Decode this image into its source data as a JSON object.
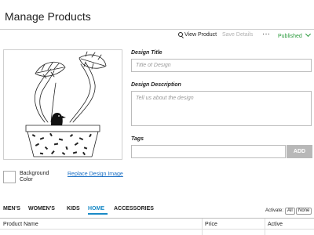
{
  "header": {
    "title": "Manage Products"
  },
  "toolbar": {
    "view_product": "View Product",
    "save_details": "Save Details",
    "more": "···",
    "status": "Published"
  },
  "design_image": {
    "icon": "monstera-plant-in-pot-illustration"
  },
  "background": {
    "label": "Background Color"
  },
  "replace_link": "Replace Design Image",
  "form": {
    "title_label": "Design Title",
    "title_placeholder": "Title of Design",
    "title_value": "",
    "description_label": "Design Description",
    "description_placeholder": "Tell us about the design",
    "description_value": "",
    "tags_label": "Tags",
    "tags_value": "",
    "add_button": "ADD"
  },
  "categories": {
    "tabs": [
      "MEN'S",
      "WOMEN'S",
      "KIDS",
      "HOME",
      "ACCESSORIES"
    ],
    "active": "HOME"
  },
  "activate": {
    "label": "Activate:",
    "all": "All",
    "none": "None"
  },
  "table": {
    "columns": [
      "Product Name",
      "Price",
      "Active"
    ]
  },
  "colors": {
    "accent": "#1a8ac6",
    "published": "#2a9a3c",
    "link": "#1a6fc4",
    "button_gray": "#b8b8b8"
  }
}
